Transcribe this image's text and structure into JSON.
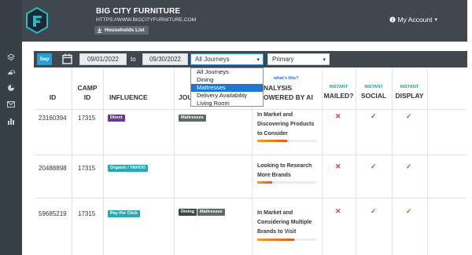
{
  "app": {
    "brand": "BIG CITY FURNITURE",
    "url": "HTTPS://WWW.BIGCITYFURNITURE.COM",
    "households_button": "Households List",
    "account_label": "My Account"
  },
  "sidebar": {
    "icons": [
      "layers-icon",
      "cars-icon",
      "pie-chart-icon",
      "mail-icon",
      "bar-chart-icon"
    ]
  },
  "filters": {
    "month_badge": "Sep",
    "start_date": "09/01/2022",
    "to_label": "to",
    "end_date": "09/30/2022",
    "journey_select": "All Journeys",
    "type_select": "Primary",
    "journey_options": [
      "All Journeys",
      "Dining",
      "Mattresses",
      "Delivery Availability",
      "Living Room"
    ],
    "highlighted_option": "Mattresses"
  },
  "table": {
    "headers": {
      "id": "ID",
      "camp_id_line1": "CAMP",
      "camp_id_line2": "ID",
      "influence": "INFLUENCE",
      "journey_partial": "JOU",
      "analysis_link": "what's this?",
      "analysis_line1": "NALYSIS",
      "analysis_line2": "OWERED BY AI",
      "mailed_sub": "INSTANT",
      "mailed": "MAILED?",
      "social_sub": "INSTANT",
      "social": "SOCIAL",
      "display_sub": "INSTANT",
      "display": "DISPLAY"
    },
    "rows": [
      {
        "id": "23160394",
        "camp_id": "17315",
        "influence": "Direct",
        "journeys": [
          "Mattresses"
        ],
        "analysis_line1": "In Market and",
        "analysis_line2": "Discovering Products",
        "analysis_line3": "to Consider",
        "mailed": "✕",
        "social": "✓",
        "display": "✓",
        "score": 0.5
      },
      {
        "id": "20488898",
        "camp_id": "17315",
        "influence": "Organic / YAHOO",
        "journeys": [],
        "analysis_line1": "Looking to Research",
        "analysis_line2": "More Brands",
        "analysis_line3": "",
        "mailed": "✕",
        "social": "✓",
        "display": "✓",
        "score": 0.25
      },
      {
        "id": "59685219",
        "camp_id": "17315",
        "influence": "Pay Per Click",
        "journeys": [
          "Dining",
          "Mattresses"
        ],
        "analysis_line1": "In Market and",
        "analysis_line2": "Considering Multiple",
        "analysis_line3": "Brands to Visit",
        "mailed": "✕",
        "social": "✓",
        "display": "✓",
        "score": 0.62
      }
    ]
  },
  "colors": {
    "header_bg": "#3f474f",
    "sidebar_bg": "#374047",
    "accent_blue": "#2a9fd6",
    "teal": "#1aa28d"
  }
}
